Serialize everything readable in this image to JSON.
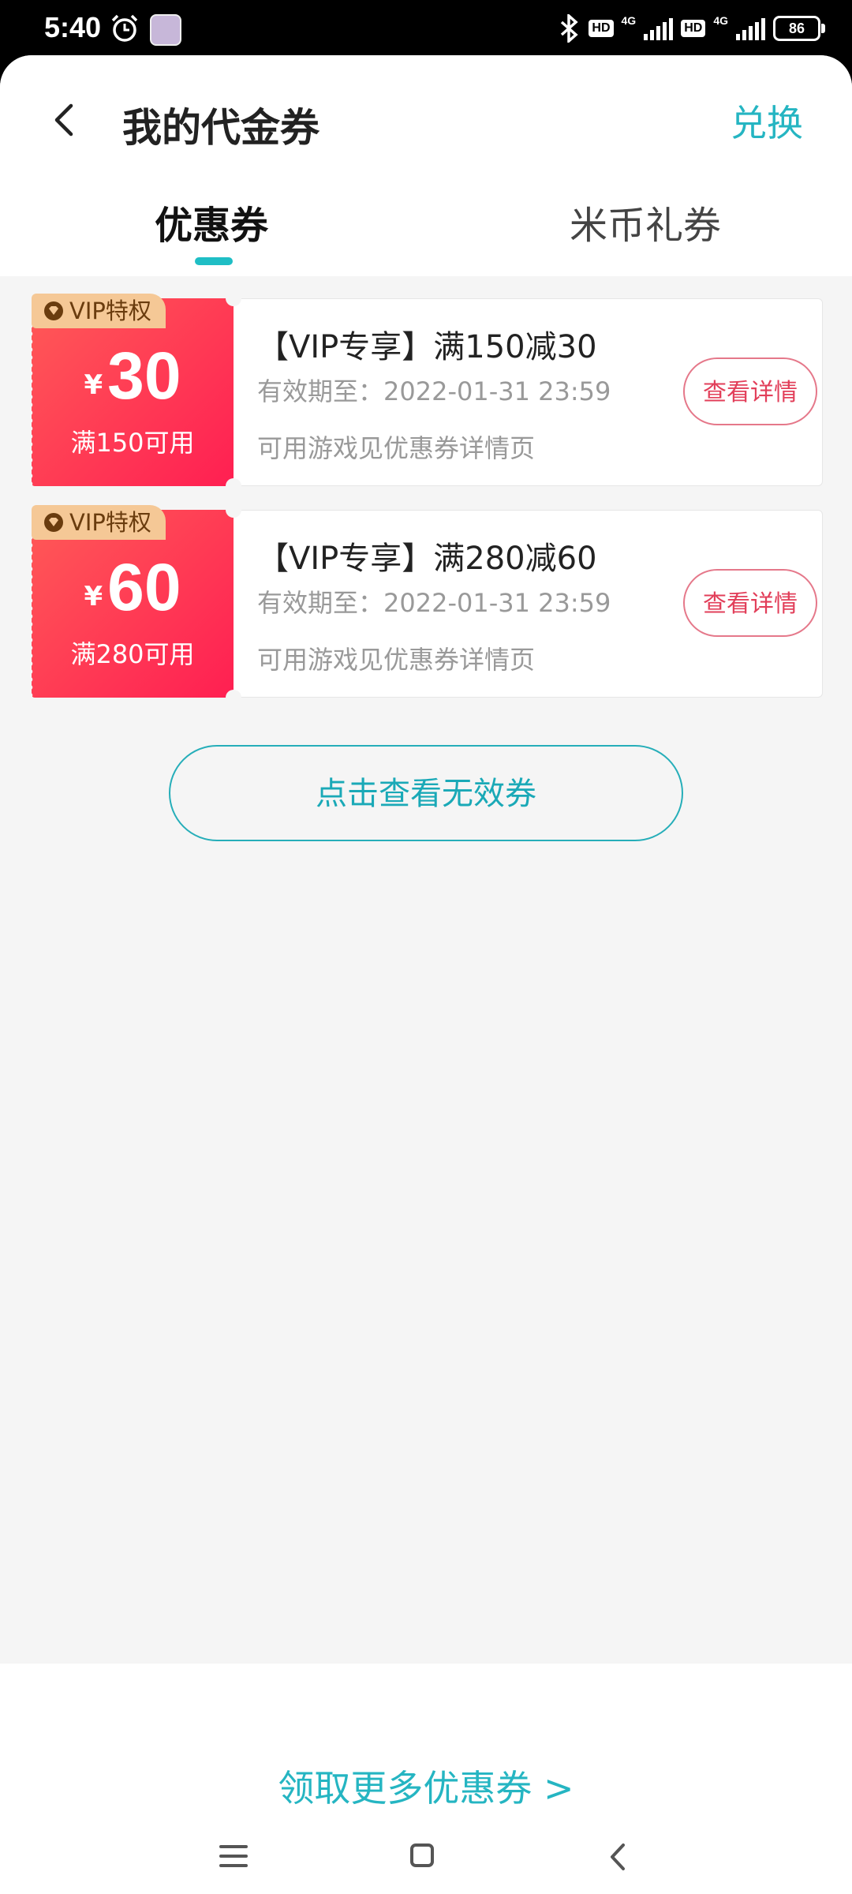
{
  "status_bar": {
    "time": "5:40",
    "network1": "4G",
    "hd": "HD",
    "network2": "4G",
    "battery": "86"
  },
  "header": {
    "title": "我的代金券",
    "exchange_label": "兑换"
  },
  "tabs": [
    {
      "label": "优惠券",
      "active": true
    },
    {
      "label": "米币礼券",
      "active": false
    }
  ],
  "coupons": [
    {
      "badge": "VIP特权",
      "currency": "¥",
      "amount": "30",
      "condition": "满150可用",
      "title": "【VIP专享】满150减30",
      "valid": "有效期至：2022-01-31 23:59",
      "note": "可用游戏见优惠券详情页",
      "detail_button": "查看详情"
    },
    {
      "badge": "VIP特权",
      "currency": "¥",
      "amount": "60",
      "condition": "满280可用",
      "title": "【VIP专享】满280减60",
      "valid": "有效期至：2022-01-31 23:59",
      "note": "可用游戏见优惠券详情页",
      "detail_button": "查看详情"
    }
  ],
  "invalid_button": "点击查看无效券",
  "footer": {
    "get_more": "领取更多优惠券 >"
  },
  "colors": {
    "accent": "#25b5c2",
    "coupon_red": "#ff2a52",
    "vip_gold": "#f5c896"
  }
}
